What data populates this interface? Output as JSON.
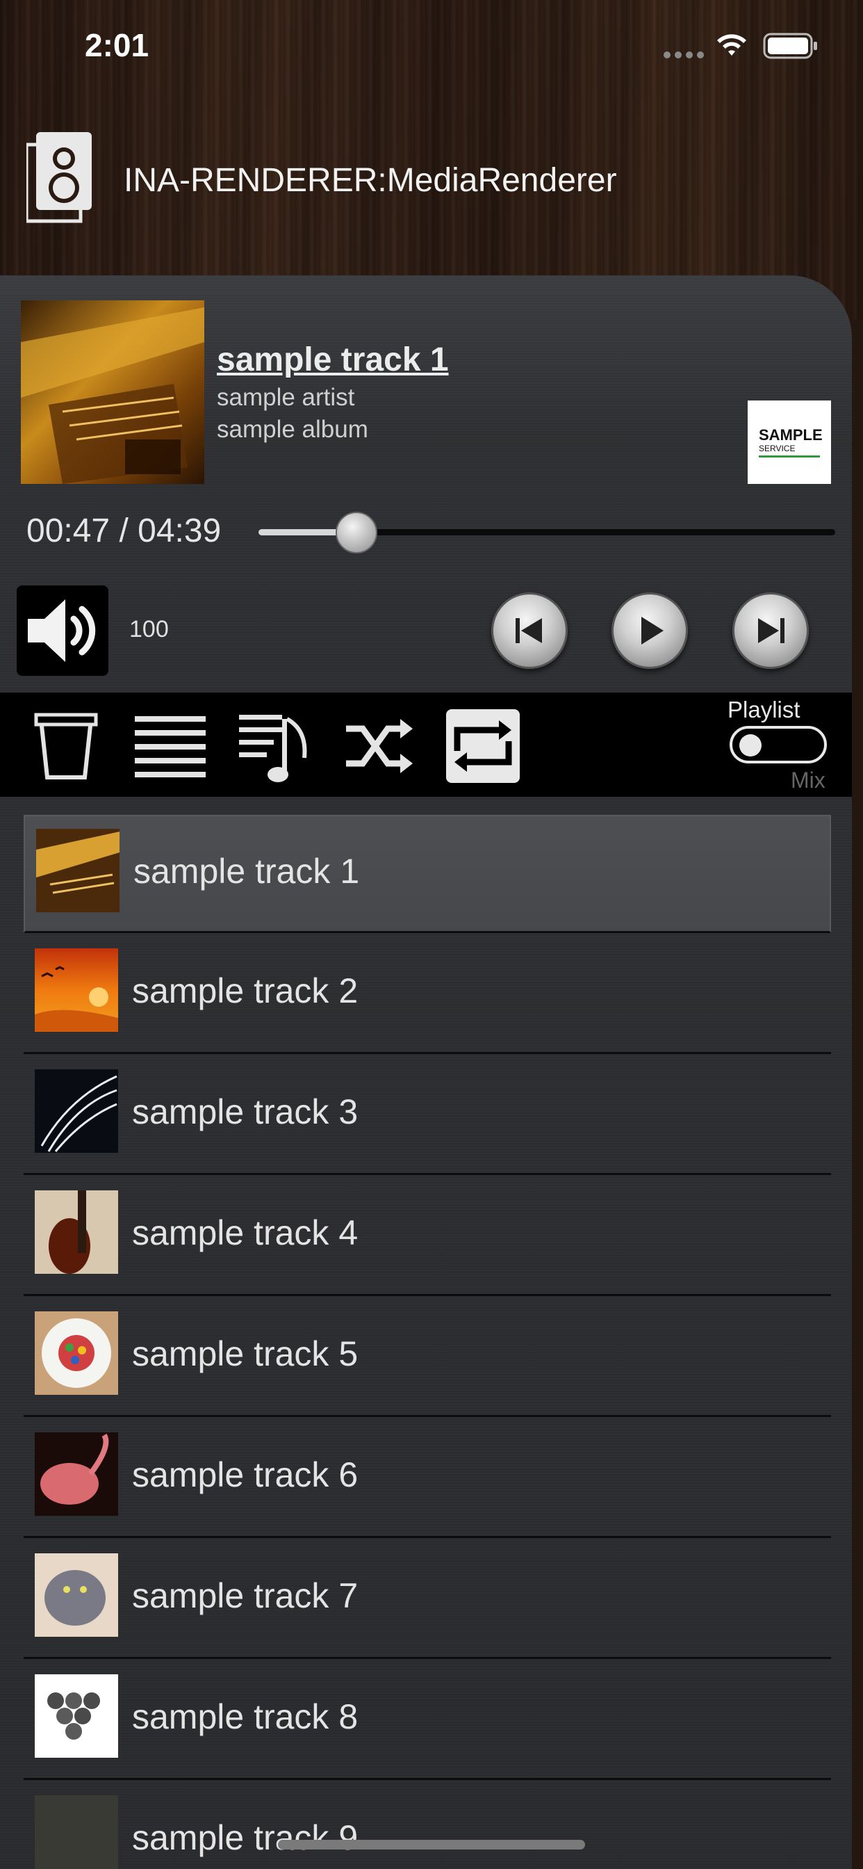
{
  "status_bar": {
    "time": "2:01"
  },
  "device": {
    "name": "INA-RENDERER:MediaRenderer",
    "icon": "speaker-icon"
  },
  "now_playing": {
    "title": "sample track 1",
    "artist": "sample artist",
    "album": "sample album",
    "service_logo": {
      "line1": "SAMPLE",
      "line2": "SERVICE"
    },
    "time_display": "00:47 / 04:39",
    "progress_fraction": 0.17
  },
  "volume": {
    "value": "100",
    "icon": "speaker-volume-icon"
  },
  "controls": {
    "previous_icon": "skip-previous-icon",
    "play_icon": "play-icon",
    "next_icon": "skip-next-icon"
  },
  "toolbar": {
    "icons": [
      "trash-icon",
      "list-icon",
      "music-queue-icon",
      "shuffle-icon",
      "repeat-icon"
    ],
    "playlist_label": "Playlist",
    "mix_label": "Mix"
  },
  "tracks": [
    {
      "label": "sample track 1",
      "active": true
    },
    {
      "label": "sample track 2",
      "active": false
    },
    {
      "label": "sample track 3",
      "active": false
    },
    {
      "label": "sample track 4",
      "active": false
    },
    {
      "label": "sample track 5",
      "active": false
    },
    {
      "label": "sample track 6",
      "active": false
    },
    {
      "label": "sample track 7",
      "active": false
    },
    {
      "label": "sample track 8",
      "active": false
    },
    {
      "label": "sample track 9",
      "active": false
    }
  ]
}
